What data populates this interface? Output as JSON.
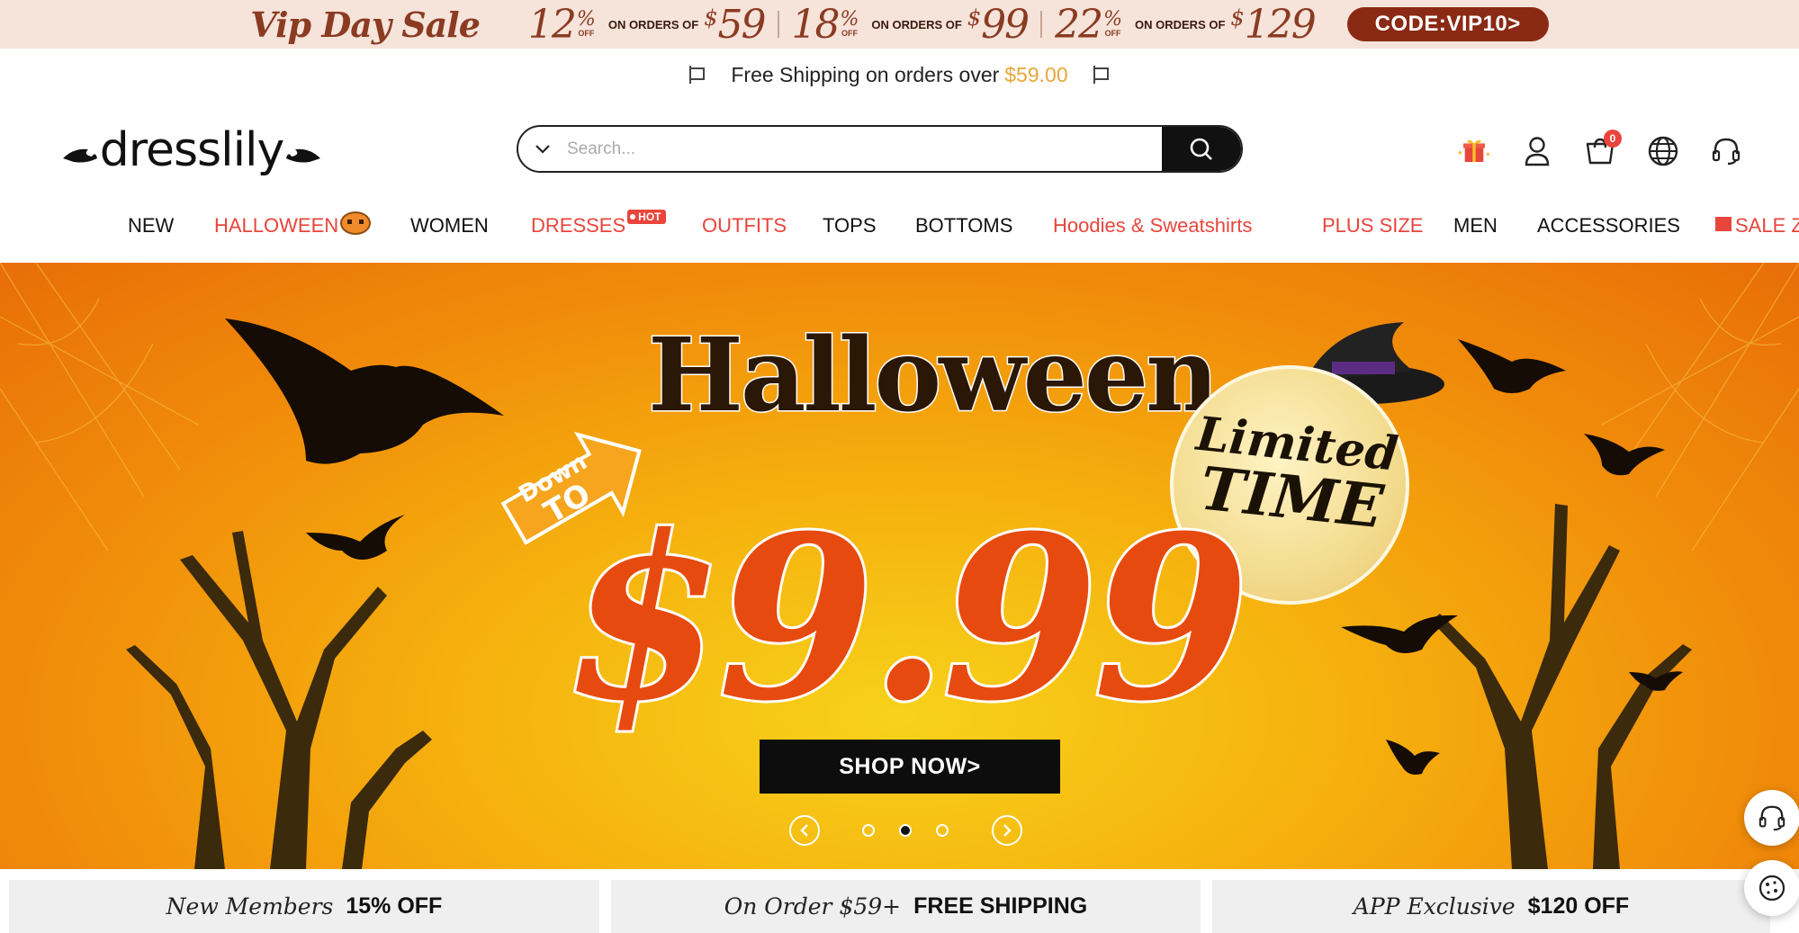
{
  "promo": {
    "vip_label": "Vip Day Sale",
    "tiers": [
      {
        "pct": "12",
        "pct_sym": "%",
        "off": "OFF",
        "on_orders": "ON ORDERS OF",
        "dollar": "$",
        "amount": "59"
      },
      {
        "pct": "18",
        "pct_sym": "%",
        "off": "OFF",
        "on_orders": "ON ORDERS OF",
        "dollar": "$",
        "amount": "99"
      },
      {
        "pct": "22",
        "pct_sym": "%",
        "off": "OFF",
        "on_orders": "ON ORDERS OF",
        "dollar": "$",
        "amount": "129"
      }
    ],
    "code_label": "CODE:VIP10>",
    "code_color": "#8a2a14"
  },
  "shipping": {
    "text": "Free Shipping on orders over",
    "amount": "$59.00"
  },
  "header": {
    "logo_text": "dresslily",
    "search_placeholder": "Search...",
    "cart_count": "0",
    "icons": [
      "gift-icon",
      "user-icon",
      "cart-icon",
      "globe-icon",
      "headset-icon"
    ]
  },
  "nav": {
    "items": [
      {
        "label": "NEW"
      },
      {
        "label": "HALLOWEEN"
      },
      {
        "label": "WOMEN"
      },
      {
        "label": "DRESSES"
      },
      {
        "label": "OUTFITS"
      },
      {
        "label": "TOPS"
      },
      {
        "label": "BOTTOMS"
      },
      {
        "label": "Hoodies & Sweatshirts"
      },
      {
        "label": "PLUS SIZE"
      },
      {
        "label": "MEN"
      },
      {
        "label": "ACCESSORIES"
      },
      {
        "label": "SALE ZO"
      }
    ],
    "hot_badge": "HOT",
    "accent_color": "#e8453c"
  },
  "hero": {
    "title": "Halloween",
    "down": "Down",
    "to": "TO",
    "price": "$9.99",
    "limited_1": "Limited",
    "limited_2": "TIME",
    "cta": "SHOP NOW>",
    "slides": 3,
    "active_slide": 2
  },
  "perks": [
    {
      "italic": "New Members",
      "bold": "15% OFF"
    },
    {
      "italic": "On Order $59+",
      "bold": "FREE SHIPPING"
    },
    {
      "italic": "APP Exclusive",
      "bold": "$120 OFF"
    }
  ]
}
